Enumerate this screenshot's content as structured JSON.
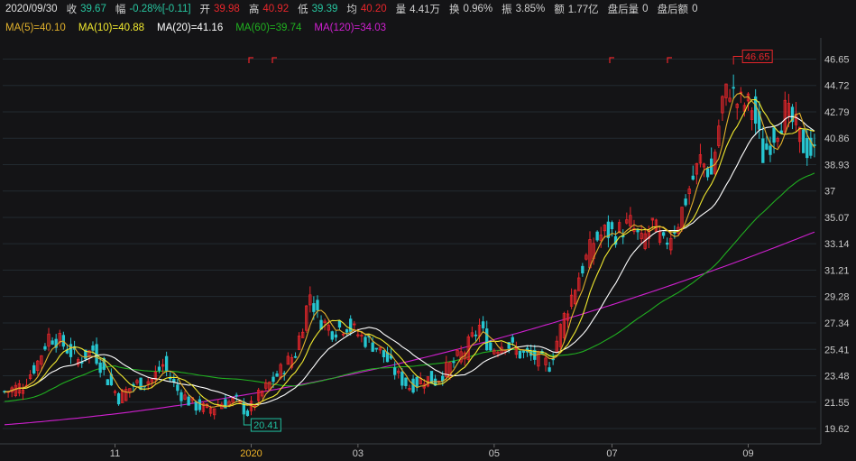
{
  "header": {
    "date": "2020/09/30",
    "close_label": "收",
    "close_value": "39.67",
    "change_label": "幅",
    "change_value": "-0.28%[-0.11]",
    "open_label": "开",
    "open_value": "39.98",
    "high_label": "高",
    "high_value": "40.92",
    "low_label": "低",
    "low_value": "39.39",
    "avg_label": "均",
    "avg_value": "40.20",
    "volume_label": "量",
    "volume_value": "4.41万",
    "turnover_label": "换",
    "turnover_value": "0.96%",
    "amplitude_label": "振",
    "amplitude_value": "3.85%",
    "amount_label": "额",
    "amount_value": "1.77亿",
    "after_vol_label": "盘后量",
    "after_vol_value": "0",
    "after_amt_label": "盘后额",
    "after_amt_value": "0"
  },
  "ma_legend": [
    {
      "label": "MA(5)=40.10",
      "color": "#e0b02c"
    },
    {
      "label": "MA(10)=40.88",
      "color": "#f2ea2f"
    },
    {
      "label": "MA(20)=41.16",
      "color": "#ffffff"
    },
    {
      "label": "MA(60)=39.74",
      "color": "#20b020"
    },
    {
      "label": "MA(120)=34.03",
      "color": "#d020d0"
    }
  ],
  "colors": {
    "up": "#e8262b",
    "down": "#27c6d1",
    "grid": "#222a30",
    "axis_text": "#c8c8c8",
    "accent_date": "#f0b428"
  },
  "chart_data": {
    "type": "candlestick",
    "ylim": [
      18.5,
      48.2
    ],
    "y_ticks": [
      "46.65",
      "44.72",
      "42.79",
      "40.86",
      "38.93",
      "37",
      "35.07",
      "33.14",
      "31.21",
      "29.28",
      "27.34",
      "25.41",
      "23.48",
      "21.55",
      "19.62"
    ],
    "x_ticks": [
      {
        "label": "11",
        "index": 30
      },
      {
        "label": "2020",
        "index": 67,
        "highlight": true
      },
      {
        "label": "03",
        "index": 96
      },
      {
        "label": "05",
        "index": 133
      },
      {
        "label": "07",
        "index": 165
      },
      {
        "label": "09",
        "index": 202
      }
    ],
    "max_marker": {
      "label": "46.65",
      "value": 46.65
    },
    "min_marker": {
      "label": "20.41",
      "value": 20.41
    },
    "anchors": [
      [
        0,
        22.3
      ],
      [
        5,
        22.8
      ],
      [
        9,
        24.5
      ],
      [
        12,
        26.4
      ],
      [
        15,
        26.0
      ],
      [
        20,
        24.6
      ],
      [
        24,
        25.4
      ],
      [
        28,
        23.2
      ],
      [
        31,
        21.9
      ],
      [
        35,
        22.8
      ],
      [
        40,
        23.2
      ],
      [
        43,
        24.3
      ],
      [
        47,
        22.4
      ],
      [
        51,
        21.4
      ],
      [
        55,
        21.0
      ],
      [
        59,
        21.5
      ],
      [
        63,
        21.6
      ],
      [
        66,
        20.8
      ],
      [
        70,
        22.3
      ],
      [
        74,
        23.5
      ],
      [
        79,
        25.2
      ],
      [
        83,
        29.5
      ],
      [
        85,
        27.8
      ],
      [
        89,
        26.8
      ],
      [
        93,
        27.2
      ],
      [
        97,
        26.3
      ],
      [
        101,
        25.6
      ],
      [
        104,
        24.6
      ],
      [
        107,
        23.4
      ],
      [
        110,
        22.7
      ],
      [
        114,
        23.3
      ],
      [
        117,
        23.1
      ],
      [
        121,
        24.2
      ],
      [
        125,
        25.3
      ],
      [
        129,
        27.1
      ],
      [
        132,
        25.4
      ],
      [
        136,
        25.9
      ],
      [
        140,
        25.1
      ],
      [
        144,
        24.8
      ],
      [
        148,
        24.3
      ],
      [
        152,
        27.8
      ],
      [
        156,
        30.8
      ],
      [
        160,
        33.3
      ],
      [
        163,
        34.0
      ],
      [
        166,
        33.9
      ],
      [
        170,
        34.6
      ],
      [
        173,
        33.2
      ],
      [
        176,
        34.6
      ],
      [
        179,
        33.0
      ],
      [
        183,
        34.8
      ],
      [
        186,
        37.2
      ],
      [
        189,
        39.3
      ],
      [
        192,
        38.2
      ],
      [
        195,
        43.6
      ],
      [
        197,
        44.6
      ],
      [
        199,
        43.5
      ],
      [
        203,
        43.2
      ],
      [
        206,
        39.6
      ],
      [
        209,
        41.2
      ],
      [
        212,
        42.8
      ],
      [
        215,
        41.6
      ],
      [
        217,
        40.3
      ],
      [
        220,
        39.7
      ]
    ]
  }
}
